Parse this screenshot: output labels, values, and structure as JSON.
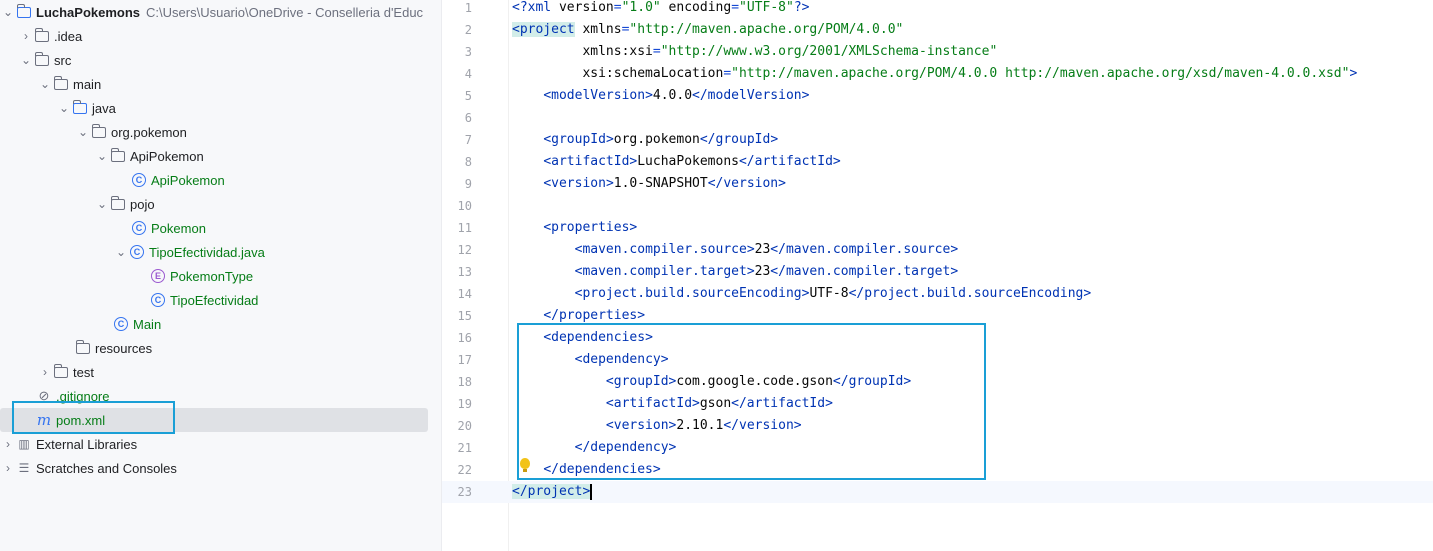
{
  "tree": {
    "root": {
      "name": "LuchaPokemons",
      "path": "C:\\Users\\Usuario\\OneDrive - Conselleria d'Educ"
    },
    "items": [
      {
        "label": ".idea"
      },
      {
        "label": "src"
      },
      {
        "label": "main"
      },
      {
        "label": "java"
      },
      {
        "label": "org.pokemon"
      },
      {
        "label": "ApiPokemon"
      },
      {
        "label": "ApiPokemon"
      },
      {
        "label": "pojo"
      },
      {
        "label": "Pokemon"
      },
      {
        "label": "TipoEfectividad.java"
      },
      {
        "label": "PokemonType"
      },
      {
        "label": "TipoEfectividad"
      },
      {
        "label": "Main"
      },
      {
        "label": "resources"
      },
      {
        "label": "test"
      },
      {
        "label": ".gitignore"
      },
      {
        "label": "pom.xml",
        "selected": true
      },
      {
        "label": "External Libraries"
      },
      {
        "label": "Scratches and Consoles"
      }
    ]
  },
  "editor": {
    "lines": [
      {
        "n": "1",
        "text": "<?xml version=\"1.0\" encoding=\"UTF-8\"?>"
      },
      {
        "n": "2",
        "text": "<project xmlns=\"http://maven.apache.org/POM/4.0.0\""
      },
      {
        "n": "3",
        "text": "         xmlns:xsi=\"http://www.w3.org/2001/XMLSchema-instance\""
      },
      {
        "n": "4",
        "text": "         xsi:schemaLocation=\"http://maven.apache.org/POM/4.0.0 http://maven.apache.org/xsd/maven-4.0.0.xsd\">"
      },
      {
        "n": "5",
        "text": "    <modelVersion>4.0.0</modelVersion>"
      },
      {
        "n": "6",
        "text": ""
      },
      {
        "n": "7",
        "text": "    <groupId>org.pokemon</groupId>"
      },
      {
        "n": "8",
        "text": "    <artifactId>LuchaPokemons</artifactId>"
      },
      {
        "n": "9",
        "text": "    <version>1.0-SNAPSHOT</version>"
      },
      {
        "n": "10",
        "text": ""
      },
      {
        "n": "11",
        "text": "    <properties>"
      },
      {
        "n": "12",
        "text": "        <maven.compiler.source>23</maven.compiler.source>"
      },
      {
        "n": "13",
        "text": "        <maven.compiler.target>23</maven.compiler.target>"
      },
      {
        "n": "14",
        "text": "        <project.build.sourceEncoding>UTF-8</project.build.sourceEncoding>"
      },
      {
        "n": "15",
        "text": "    </properties>"
      },
      {
        "n": "16",
        "text": "    <dependencies>"
      },
      {
        "n": "17",
        "text": "        <dependency>"
      },
      {
        "n": "18",
        "text": "            <groupId>com.google.code.gson</groupId>"
      },
      {
        "n": "19",
        "text": "            <artifactId>gson</artifactId>"
      },
      {
        "n": "20",
        "text": "            <version>2.10.1</version>"
      },
      {
        "n": "21",
        "text": "        </dependency>"
      },
      {
        "n": "22",
        "text": "    </dependencies>"
      },
      {
        "n": "23",
        "text": "</project>"
      }
    ]
  },
  "colors": {
    "highlight_box": "#1a9fd6",
    "selection": "#dfe1e5"
  }
}
